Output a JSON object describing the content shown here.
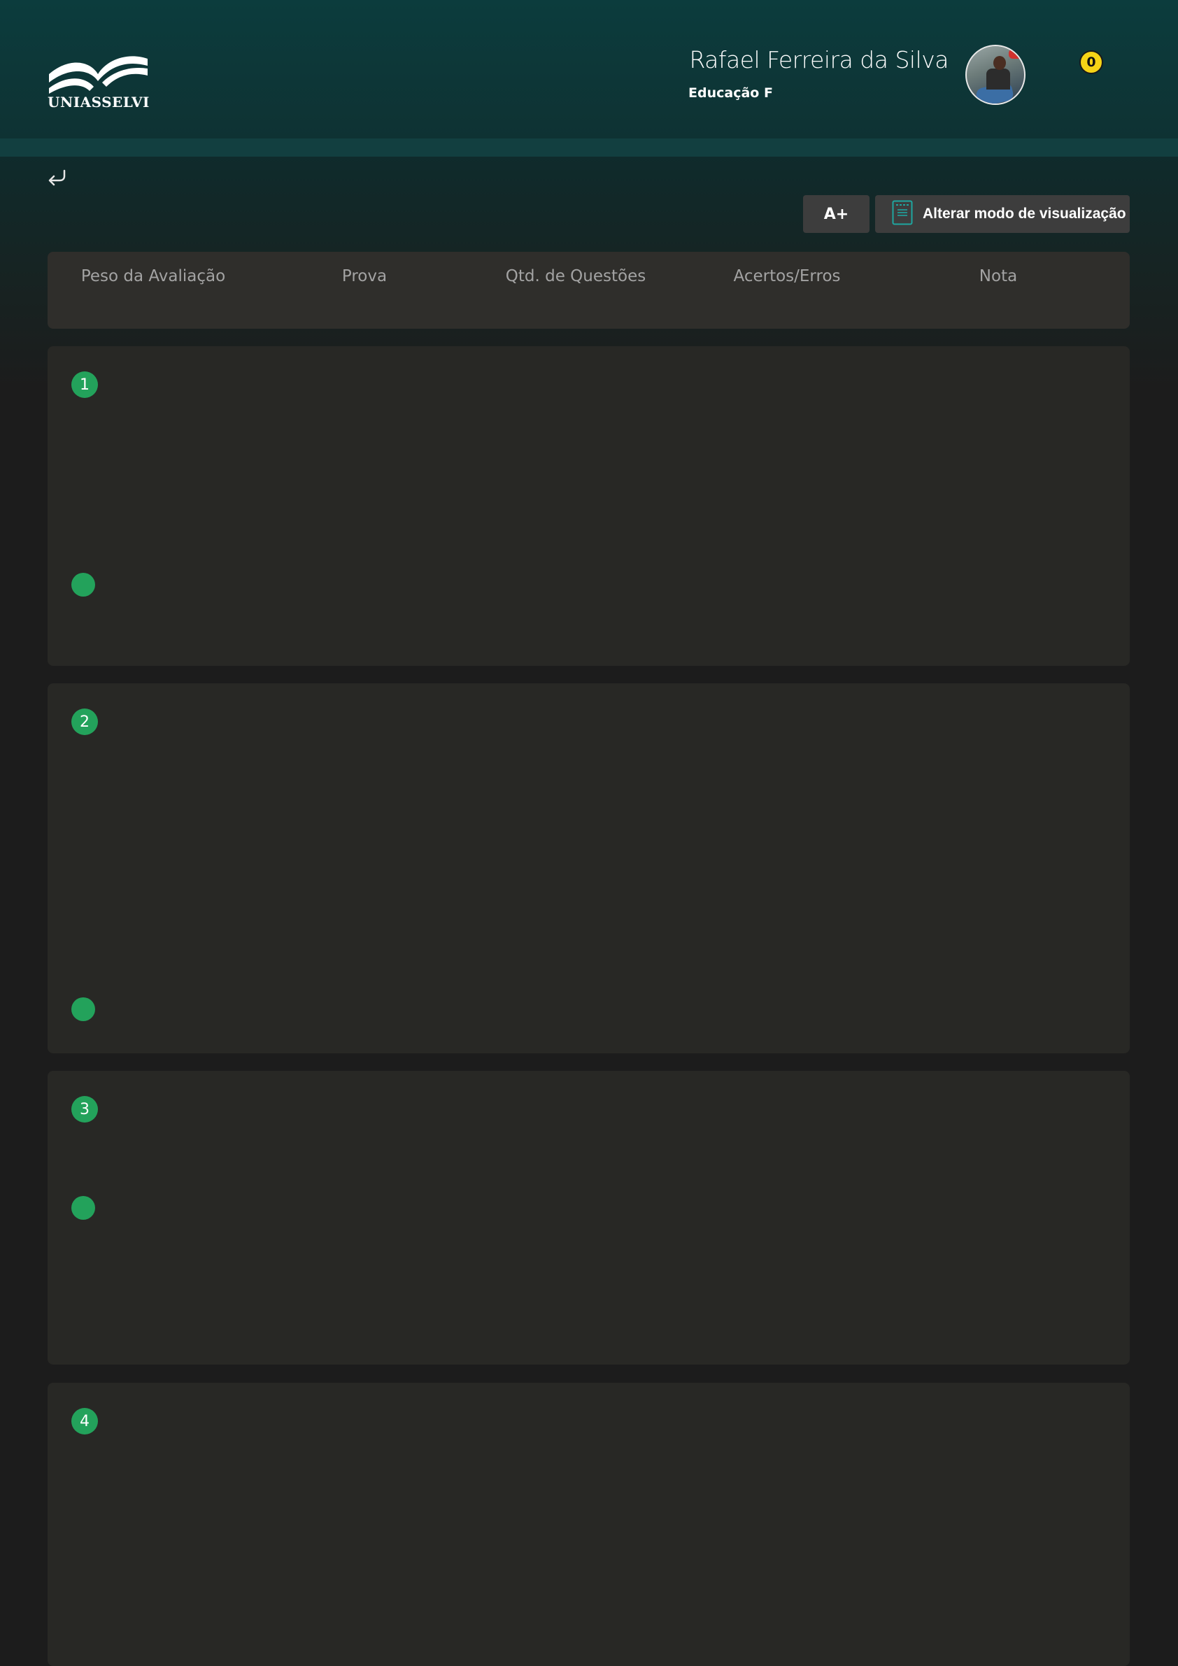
{
  "header": {
    "logo_text": "UNIASSELVI",
    "user_name": "Rafael Ferreira da Silva",
    "course": "Educação F",
    "notification_count": "0"
  },
  "toolbar": {
    "font_size_label": "A+",
    "view_mode_label": "Alterar modo de visualização"
  },
  "summary": {
    "columns": [
      "Peso da Avaliação",
      "Prova",
      "Qtd. de Questões",
      "Acertos/Erros",
      "Nota"
    ]
  },
  "questions": [
    {
      "number": "1"
    },
    {
      "number": "2"
    },
    {
      "number": "3"
    },
    {
      "number": "4"
    }
  ],
  "colors": {
    "accent_green": "#23a25b",
    "badge_yellow": "#f6d416",
    "header_teal": "#0c3c3d",
    "card_bg": "#282825"
  }
}
